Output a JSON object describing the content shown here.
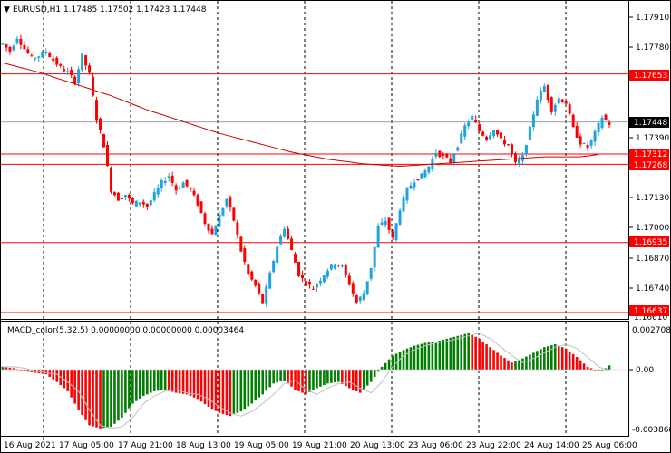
{
  "main_header": {
    "triangle": "▼",
    "text": "EURUSD,H1  1.17485 1.17502 1.17423 1.17448"
  },
  "macd_header": {
    "text": "MACD_color(5,32,5) 0.00000000 0.00000000 0.00003464"
  },
  "price_axis": {
    "ticks": [
      "1.17910",
      "1.17780",
      "1.17390",
      "1.17130",
      "1.17000",
      "1.16870",
      "1.16740",
      "1.16610"
    ]
  },
  "macd_axis": {
    "ticks": [
      "0.0027083",
      "0.00",
      "-0.003868"
    ]
  },
  "time_axis": {
    "labels": [
      "16 Aug 2021",
      "17 Aug 05:00",
      "17 Aug 21:00",
      "18 Aug 13:00",
      "19 Aug 05:00",
      "19 Aug 21:00",
      "20 Aug 13:00",
      "23 Aug 06:00",
      "23 Aug 22:00",
      "24 Aug 14:00",
      "25 Aug 06:00"
    ]
  },
  "price_labels": {
    "level_top": "1.17653",
    "current": "1.17448",
    "level_a": "1.17312",
    "level_b": "1.17268",
    "level_low": "1.16935",
    "level_bottom": "1.16637"
  },
  "colors": {
    "bull": "#1fa3df",
    "bear": "#ff0000",
    "ma": "#cc0000",
    "hline": "#ff0000",
    "macd_pos_up": "#008000",
    "macd_neg": "#ff0000",
    "grid_separator": "#000000",
    "current_line": "#708090"
  },
  "chart_data": {
    "type": "candlestick",
    "symbol": "EURUSD",
    "timeframe": "H1",
    "ylim": [
      1.1661,
      1.1796
    ],
    "horizontal_levels": [
      1.17653,
      1.17312,
      1.17268,
      1.16935,
      1.16637
    ],
    "current_price": 1.17448,
    "close_path": [
      [
        0,
        1.1778
      ],
      [
        4,
        1.1775
      ],
      [
        8,
        1.1781
      ],
      [
        12,
        1.1776
      ],
      [
        16,
        1.1772
      ],
      [
        20,
        1.1773
      ],
      [
        24,
        1.1775
      ],
      [
        28,
        1.1771
      ],
      [
        32,
        1.1768
      ],
      [
        36,
        1.1766
      ],
      [
        40,
        1.1762
      ],
      [
        44,
        1.1773
      ],
      [
        48,
        1.1765
      ],
      [
        52,
        1.1746
      ],
      [
        56,
        1.1735
      ],
      [
        60,
        1.1716
      ],
      [
        64,
        1.1712
      ],
      [
        68,
        1.1714
      ],
      [
        72,
        1.171
      ],
      [
        76,
        1.1711
      ],
      [
        80,
        1.1709
      ],
      [
        84,
        1.1714
      ],
      [
        88,
        1.1719
      ],
      [
        92,
        1.1722
      ],
      [
        96,
        1.1716
      ],
      [
        100,
        1.1719
      ],
      [
        104,
        1.1716
      ],
      [
        108,
        1.171
      ],
      [
        112,
        1.1702
      ],
      [
        116,
        1.1697
      ],
      [
        120,
        1.1705
      ],
      [
        124,
        1.1712
      ],
      [
        128,
        1.1703
      ],
      [
        132,
        1.169
      ],
      [
        136,
        1.168
      ],
      [
        140,
        1.1675
      ],
      [
        144,
        1.1668
      ],
      [
        148,
        1.168
      ],
      [
        152,
        1.1692
      ],
      [
        156,
        1.17
      ],
      [
        160,
        1.169
      ],
      [
        164,
        1.168
      ],
      [
        168,
        1.1676
      ],
      [
        172,
        1.1674
      ],
      [
        176,
        1.1678
      ],
      [
        180,
        1.1682
      ],
      [
        184,
        1.1685
      ],
      [
        188,
        1.1683
      ],
      [
        192,
        1.1676
      ],
      [
        196,
        1.1668
      ],
      [
        200,
        1.1672
      ],
      [
        204,
        1.1683
      ],
      [
        208,
        1.17
      ],
      [
        212,
        1.1703
      ],
      [
        216,
        1.1695
      ],
      [
        220,
        1.1708
      ],
      [
        224,
        1.1716
      ],
      [
        228,
        1.172
      ],
      [
        232,
        1.1722
      ],
      [
        236,
        1.1726
      ],
      [
        240,
        1.1732
      ],
      [
        244,
        1.173
      ],
      [
        248,
        1.1728
      ],
      [
        252,
        1.1735
      ],
      [
        256,
        1.1743
      ],
      [
        260,
        1.1747
      ],
      [
        264,
        1.1741
      ],
      [
        268,
        1.1738
      ],
      [
        272,
        1.1742
      ],
      [
        276,
        1.1737
      ],
      [
        280,
        1.1735
      ],
      [
        284,
        1.1727
      ],
      [
        288,
        1.173
      ],
      [
        292,
        1.1742
      ],
      [
        296,
        1.1755
      ],
      [
        300,
        1.176
      ],
      [
        304,
        1.175
      ],
      [
        308,
        1.1755
      ],
      [
        312,
        1.1753
      ],
      [
        316,
        1.1742
      ],
      [
        320,
        1.1736
      ],
      [
        324,
        1.1734
      ],
      [
        328,
        1.174
      ],
      [
        332,
        1.1747
      ],
      [
        336,
        1.1744
      ]
    ],
    "ma_path": [
      [
        0,
        1.177
      ],
      [
        20,
        1.1766
      ],
      [
        40,
        1.1761
      ],
      [
        60,
        1.1756
      ],
      [
        80,
        1.175
      ],
      [
        100,
        1.1745
      ],
      [
        120,
        1.174
      ],
      [
        140,
        1.1736
      ],
      [
        160,
        1.1732
      ],
      [
        180,
        1.1729
      ],
      [
        200,
        1.1727
      ],
      [
        220,
        1.1726
      ],
      [
        240,
        1.1727
      ],
      [
        260,
        1.1728
      ],
      [
        280,
        1.1729
      ],
      [
        300,
        1.173
      ],
      [
        320,
        1.173
      ],
      [
        330,
        1.1731
      ]
    ],
    "macd_path": [
      [
        0,
        0.0002
      ],
      [
        6,
        0.0001
      ],
      [
        12,
        -0.0001
      ],
      [
        18,
        -0.0002
      ],
      [
        24,
        -0.0003
      ],
      [
        30,
        -0.0008
      ],
      [
        36,
        -0.0014
      ],
      [
        42,
        -0.0026
      ],
      [
        48,
        -0.0036
      ],
      [
        54,
        -0.0038
      ],
      [
        60,
        -0.0037
      ],
      [
        66,
        -0.0031
      ],
      [
        72,
        -0.0022
      ],
      [
        78,
        -0.0017
      ],
      [
        84,
        -0.0014
      ],
      [
        90,
        -0.0013
      ],
      [
        96,
        -0.0015
      ],
      [
        102,
        -0.0016
      ],
      [
        108,
        -0.0019
      ],
      [
        114,
        -0.0024
      ],
      [
        120,
        -0.0028
      ],
      [
        126,
        -0.003
      ],
      [
        132,
        -0.0027
      ],
      [
        138,
        -0.0022
      ],
      [
        144,
        -0.0016
      ],
      [
        150,
        -0.0009
      ],
      [
        156,
        -0.0007
      ],
      [
        162,
        -0.0013
      ],
      [
        168,
        -0.0016
      ],
      [
        174,
        -0.0012
      ],
      [
        180,
        -0.0009
      ],
      [
        186,
        -0.0008
      ],
      [
        192,
        -0.0012
      ],
      [
        198,
        -0.0015
      ],
      [
        204,
        -0.0008
      ],
      [
        210,
        0.0002
      ],
      [
        216,
        0.001
      ],
      [
        222,
        0.0014
      ],
      [
        228,
        0.0017
      ],
      [
        234,
        0.0019
      ],
      [
        240,
        0.002
      ],
      [
        246,
        0.0022
      ],
      [
        252,
        0.0024
      ],
      [
        258,
        0.0026
      ],
      [
        264,
        0.0022
      ],
      [
        270,
        0.0016
      ],
      [
        276,
        0.001
      ],
      [
        282,
        0.0005
      ],
      [
        288,
        0.0008
      ],
      [
        294,
        0.0012
      ],
      [
        300,
        0.0016
      ],
      [
        306,
        0.0018
      ],
      [
        312,
        0.0015
      ],
      [
        318,
        0.0009
      ],
      [
        324,
        0.0002
      ],
      [
        330,
        -0.0001
      ],
      [
        334,
        0.0001
      ],
      [
        336,
        0.0003
      ]
    ]
  }
}
